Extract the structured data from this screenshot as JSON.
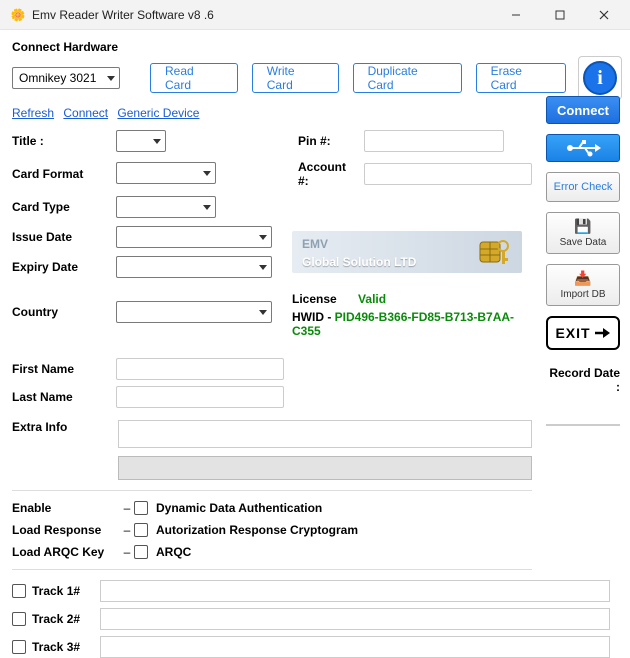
{
  "window": {
    "title": "Emv Reader Writer Software v8 .6"
  },
  "hardware": {
    "label": "Connect Hardware",
    "device": "Omnikey 3021",
    "links": {
      "refresh": "Refresh",
      "connect": "Connect",
      "generic": "Generic Device"
    }
  },
  "top_buttons": {
    "read": "Read Card",
    "write": "Write Card",
    "duplicate": "Duplicate Card",
    "erase": "Erase Card"
  },
  "side": {
    "connect": "Connect",
    "error_check": "Error Check",
    "save_data": "Save Data",
    "import_db": "Import DB",
    "exit": "EXIT",
    "record_date_label": "Record Date :",
    "record_date_value": ""
  },
  "fields": {
    "title": "Title :",
    "pin": "Pin #:",
    "card_format": "Card Format",
    "account": "Account #:",
    "card_type": "Card Type",
    "issue_date": "Issue Date",
    "expiry_date": "Expiry Date",
    "country": "Country",
    "first_name": "First Name",
    "last_name": "Last Name",
    "extra_info": "Extra Info"
  },
  "banner": {
    "line1": "EMV",
    "line2": "Global Solution LTD"
  },
  "license": {
    "label": "License",
    "status": "Valid"
  },
  "hwid": {
    "label": "HWID - ",
    "value": "PID496-B366-FD85-B713-B7AA-C355"
  },
  "options": {
    "enable": "Enable",
    "load_response": "Load Response",
    "load_arqc_key": "Load ARQC Key",
    "dda": "Dynamic Data Authentication",
    "arc": "Autorization Response Cryptogram",
    "arqc": "ARQC"
  },
  "tracks": {
    "t1": "Track 1#",
    "t2": "Track 2#",
    "t3": "Track 3#"
  }
}
